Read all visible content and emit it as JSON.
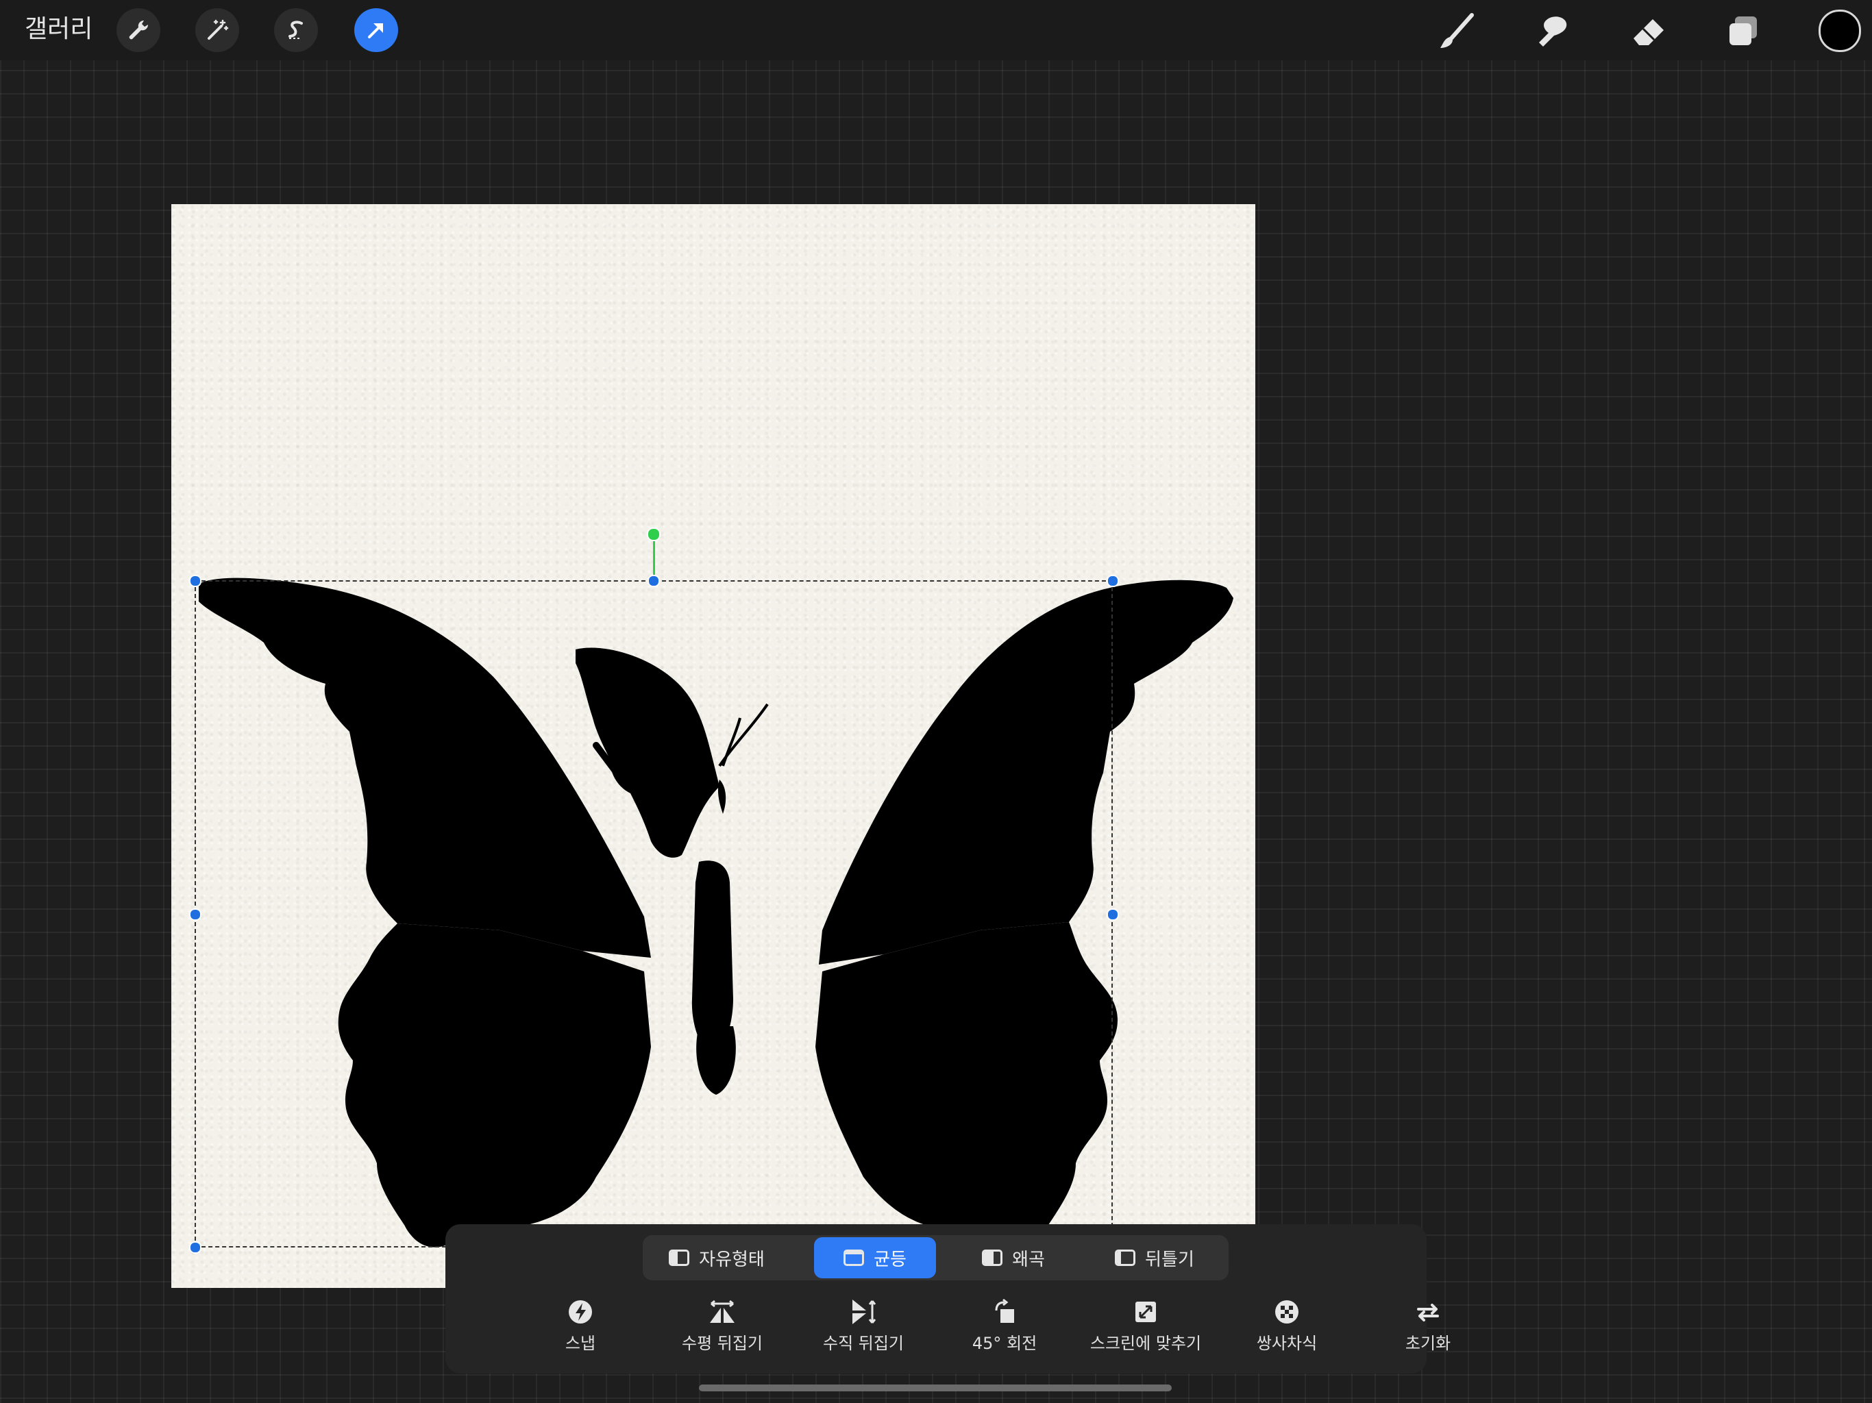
{
  "topbar": {
    "gallery_label": "갤러리",
    "left_tools": [
      "wrench-icon",
      "magic-wand-icon",
      "selection-s-icon",
      "move-arrow-icon"
    ],
    "active_tool": "move-arrow-icon",
    "right_tools": [
      "brush-icon",
      "smudge-icon",
      "eraser-icon",
      "layers-icon"
    ],
    "current_color": "#000000"
  },
  "transform_panel": {
    "modes": [
      {
        "label": "자유형태",
        "active": false
      },
      {
        "label": "균등",
        "active": true
      },
      {
        "label": "왜곡",
        "active": false
      },
      {
        "label": "뒤틀기",
        "active": false
      }
    ],
    "actions": [
      {
        "label": "스냅",
        "icon": "snap-bolt-icon"
      },
      {
        "label": "수평 뒤집기",
        "icon": "flip-horizontal-icon"
      },
      {
        "label": "수직 뒤집기",
        "icon": "flip-vertical-icon"
      },
      {
        "label": "45° 회전",
        "icon": "rotate-45-icon"
      },
      {
        "label": "스크린에 맞추기",
        "icon": "fit-to-screen-icon"
      },
      {
        "label": "쌍사차식",
        "icon": "bicubic-icon"
      },
      {
        "label": "초기화",
        "icon": "reset-icon"
      }
    ]
  },
  "colors": {
    "accent": "#2f7bf5",
    "rotation_handle": "#2fcf4c",
    "canvas_paper": "#f3f1e9"
  }
}
